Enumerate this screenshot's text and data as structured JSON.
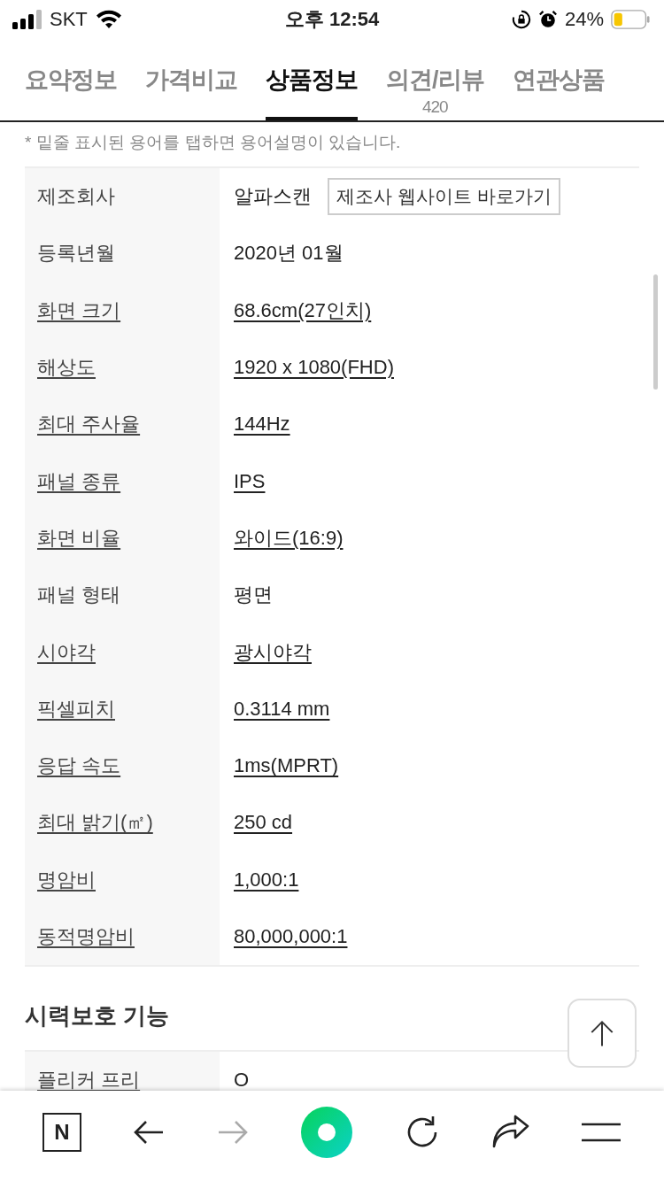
{
  "status_bar": {
    "carrier": "SKT",
    "time": "오후 12:54",
    "battery": "24%"
  },
  "tabs": [
    {
      "label": "요약정보",
      "selected": false
    },
    {
      "label": "가격비교",
      "selected": false
    },
    {
      "label": "상품정보",
      "selected": true
    },
    {
      "label": "의견/리뷰",
      "count": "420",
      "selected": false
    },
    {
      "label": "연관상품",
      "selected": false
    }
  ],
  "note": "* 밑줄 표시된 용어를 탭하면 용어설명이 있습니다.",
  "spec_table": {
    "rows": [
      {
        "label": "제조회사",
        "label_underlined": false,
        "value": "알파스캔",
        "value_underlined": false,
        "button": "제조사 웹사이트 바로가기"
      },
      {
        "label": "등록년월",
        "label_underlined": false,
        "value": "2020년 01월",
        "value_underlined": false
      },
      {
        "label": "화면 크기",
        "label_underlined": true,
        "value": "68.6cm(27인치)",
        "value_underlined": true
      },
      {
        "label": "해상도",
        "label_underlined": true,
        "value": "1920 x 1080(FHD)",
        "value_underlined": true
      },
      {
        "label": "최대 주사율",
        "label_underlined": true,
        "value": "144Hz",
        "value_underlined": true
      },
      {
        "label": "패널 종류",
        "label_underlined": true,
        "value": "IPS",
        "value_underlined": true
      },
      {
        "label": "화면 비율",
        "label_underlined": true,
        "value": "와이드(16:9)",
        "value_underlined": true
      },
      {
        "label": "패널 형태",
        "label_underlined": false,
        "value": "평면",
        "value_underlined": false
      },
      {
        "label": "시야각",
        "label_underlined": true,
        "value": "광시야각",
        "value_underlined": true
      },
      {
        "label": "픽셀피치",
        "label_underlined": true,
        "value": "0.3114 mm",
        "value_underlined": true
      },
      {
        "label": "응답 속도",
        "label_underlined": true,
        "value": "1ms(MPRT)",
        "value_underlined": true
      },
      {
        "label": "최대 밝기(㎡)",
        "label_underlined": true,
        "value": "250 cd",
        "value_underlined": true
      },
      {
        "label": "명암비",
        "label_underlined": true,
        "value": "1,000:1",
        "value_underlined": true
      },
      {
        "label": "동적명암비",
        "label_underlined": true,
        "value": "80,000,000:1",
        "value_underlined": true
      }
    ]
  },
  "section": {
    "title": "시력보호 기능",
    "rows": [
      {
        "label": "플리커 프리",
        "label_underlined": true,
        "value": "O",
        "value_underlined": false
      }
    ]
  },
  "bottom_bar": {
    "logo": "N"
  }
}
